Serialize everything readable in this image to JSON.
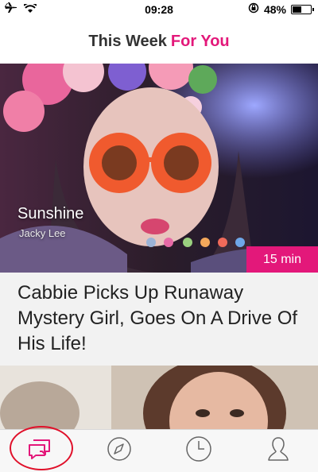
{
  "status_bar": {
    "time": "09:28",
    "battery": "48%",
    "battery_level": 0.48,
    "icons": [
      "airplane-icon",
      "wifi-icon",
      "orientation-lock-icon",
      "battery-icon"
    ]
  },
  "header": {
    "title_prefix": "This Week",
    "title_accent": "For You",
    "accent_color": "#e3187a"
  },
  "featured": {
    "title": "Sunshine",
    "author": "Jacky Lee",
    "duration": "15 min",
    "headline": "Cabbie Picks Up Runaway Mystery Girl, Goes On A Drive Of His Life!"
  },
  "tab_bar": {
    "tabs": [
      {
        "icon": "chat-bubbles-icon",
        "active": true,
        "color": "#e3187a"
      },
      {
        "icon": "compass-icon",
        "active": false
      },
      {
        "icon": "clock-icon",
        "active": false
      },
      {
        "icon": "profile-icon",
        "active": false
      }
    ]
  }
}
